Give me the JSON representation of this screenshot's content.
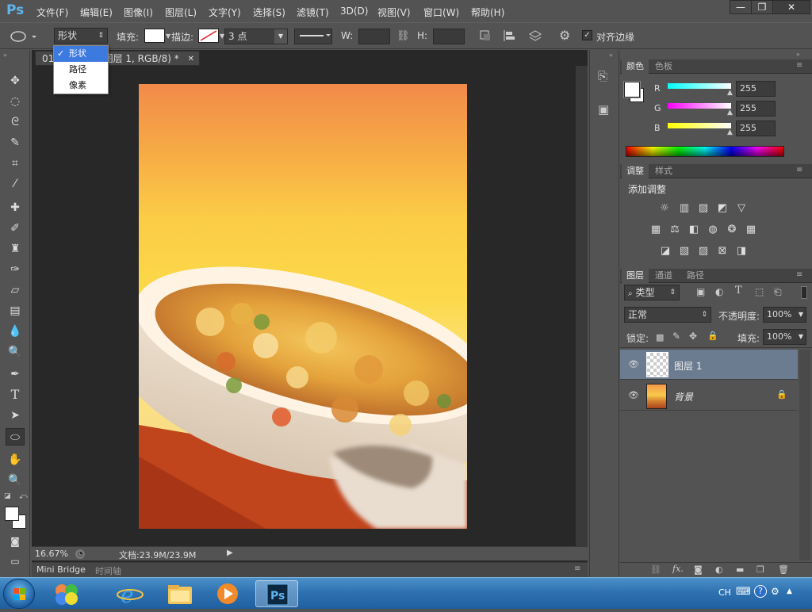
{
  "app": {
    "logo": "Ps"
  },
  "menu": [
    "文件(F)",
    "编辑(E)",
    "图像(I)",
    "图层(L)",
    "文字(Y)",
    "选择(S)",
    "滤镜(T)",
    "3D(D)",
    "视图(V)",
    "窗口(W)",
    "帮助(H)"
  ],
  "window_buttons": [
    "—",
    "❐",
    "✕"
  ],
  "options": {
    "mode_value": "形状",
    "mode_options": [
      "形状",
      "路径",
      "像素"
    ],
    "fill_label": "填充:",
    "stroke_label": "描边:",
    "stroke_width": "3 点",
    "w_label": "W:",
    "h_label": "H:",
    "align_edges_label": "对齐边缘",
    "align_edges_checked": true
  },
  "document": {
    "tab_title_prefix": "01.",
    "tab_title": "(图层 1, RGB/8) *",
    "zoom": "16.67%",
    "doc_info": "文档:23.9M/23.9M"
  },
  "bottom_tabs": [
    "Mini Bridge",
    "时间轴"
  ],
  "color_panel": {
    "tabs": [
      "颜色",
      "色板"
    ],
    "r_label": "R",
    "g_label": "G",
    "b_label": "B",
    "r": "255",
    "g": "255",
    "b": "255"
  },
  "adjust_panel": {
    "tabs": [
      "调整",
      "样式"
    ],
    "title": "添加调整"
  },
  "layers_panel": {
    "tabs": [
      "图层",
      "通道",
      "路径"
    ],
    "filter_kind": "类型",
    "blend_mode": "正常",
    "opacity_label": "不透明度:",
    "opacity": "100%",
    "lock_label": "锁定:",
    "fill_label": "填充:",
    "fill": "100%",
    "layers": [
      {
        "name": "图层 1",
        "selected": true
      },
      {
        "name": "背景",
        "selected": false,
        "locked": true
      }
    ]
  },
  "taskbar": {
    "lang": "CH"
  },
  "colors": {
    "accent": "#3d7ae0",
    "ps_blue": "#5fb5f0"
  }
}
